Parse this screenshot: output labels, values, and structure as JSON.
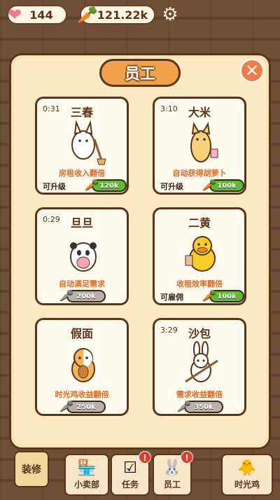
{
  "topbar": {
    "hearts": "144",
    "carrots": "121.22k"
  },
  "modal": {
    "title": "员工",
    "close_label": "✕"
  },
  "staff": [
    {
      "timer": "0:31",
      "name": "三春",
      "desc": "房租收入翻倍",
      "status": "可升级",
      "price": "120k",
      "price_style": "green"
    },
    {
      "timer": "3:10",
      "name": "大米",
      "desc": "自动获得胡萝卜",
      "status": "可升级",
      "price": "100k",
      "price_style": "green"
    },
    {
      "timer": "0:29",
      "name": "旦旦",
      "desc": "自动满足需求",
      "status": "",
      "price": "200k",
      "price_style": "grey"
    },
    {
      "timer": "",
      "name": "二黄",
      "desc": "收租效率翻倍",
      "status": "可雇佣",
      "price": "100k",
      "price_style": "green"
    },
    {
      "timer": "",
      "name": "假面",
      "desc": "时光鸡收益翻倍",
      "status": "",
      "price": "250k",
      "price_style": "grey"
    },
    {
      "timer": "3:29",
      "name": "沙包",
      "desc": "需求收益翻倍",
      "status": "",
      "price": "350k",
      "price_style": "grey"
    }
  ],
  "nav": {
    "decor": "装修",
    "shop": "小卖部",
    "task": "任务",
    "staff": "员工",
    "chicken": "时光鸡",
    "badge": "!"
  },
  "colors": {
    "accent": "#f0a14a",
    "price_green": "#5cbb2f",
    "price_grey": "#b9b0a8",
    "desc_orange": "#e36a1f"
  }
}
